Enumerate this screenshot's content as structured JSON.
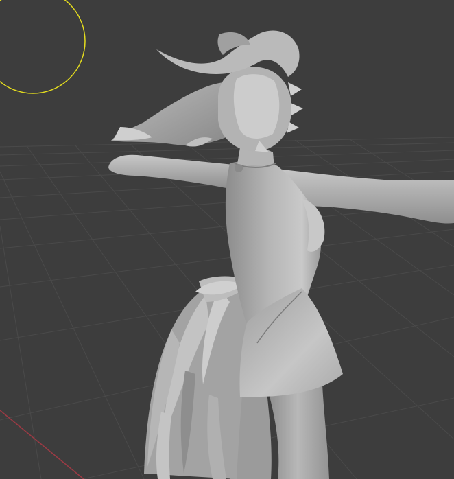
{
  "app": {
    "view": "3D Viewport",
    "shading": "solid"
  },
  "colors": {
    "background": "#3d3d3d",
    "grid_line": "#4a4a4a",
    "x_axis": "#9c3a44",
    "light_gizmo": "#e4dc1e",
    "model_base": "#a9a9a9",
    "model_highlight": "#d2d2d2",
    "model_shadow": "#6f6f6f"
  },
  "scene": {
    "light": {
      "type": "point-light",
      "icon": "light-circle-gizmo"
    },
    "object": {
      "type": "mesh",
      "icon": "character-mesh"
    },
    "floor": {
      "icon": "floor-grid"
    }
  }
}
